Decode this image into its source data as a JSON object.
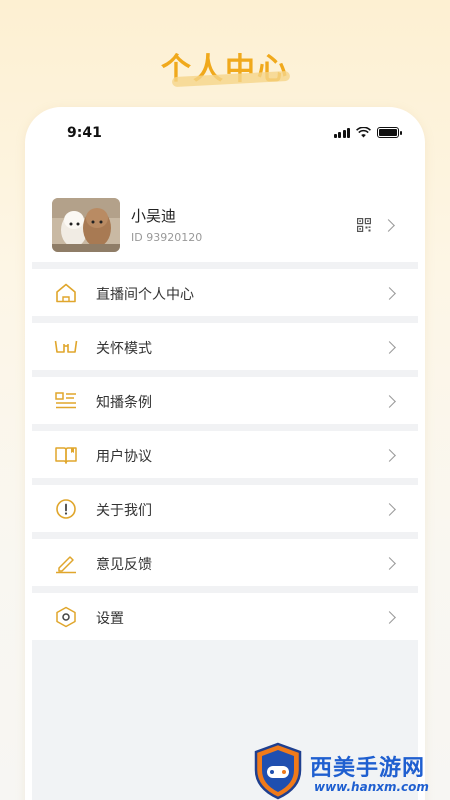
{
  "hero": {
    "title": "个人中心"
  },
  "status_bar": {
    "time": "9:41"
  },
  "profile": {
    "name": "小吴迪",
    "id_text": "ID 93920120"
  },
  "menu": [
    {
      "label": "直播间个人中心",
      "icon": "home-icon"
    },
    {
      "label": "关怀模式",
      "icon": "glasses-icon"
    },
    {
      "label": "知播条例",
      "icon": "list-doc-icon"
    },
    {
      "label": "用户协议",
      "icon": "book-icon"
    },
    {
      "label": "关于我们",
      "icon": "info-circle-icon"
    },
    {
      "label": "意见反馈",
      "icon": "pencil-icon"
    },
    {
      "label": "设置",
      "icon": "settings-hex-icon"
    }
  ],
  "watermark": {
    "name": "西美手游网",
    "url": "www.hanxm.com"
  },
  "colors": {
    "accent": "#e0a62c",
    "brand_title": "#f0a91c",
    "divider": "#f1f2f4",
    "watermark": "#1f5fd0"
  }
}
